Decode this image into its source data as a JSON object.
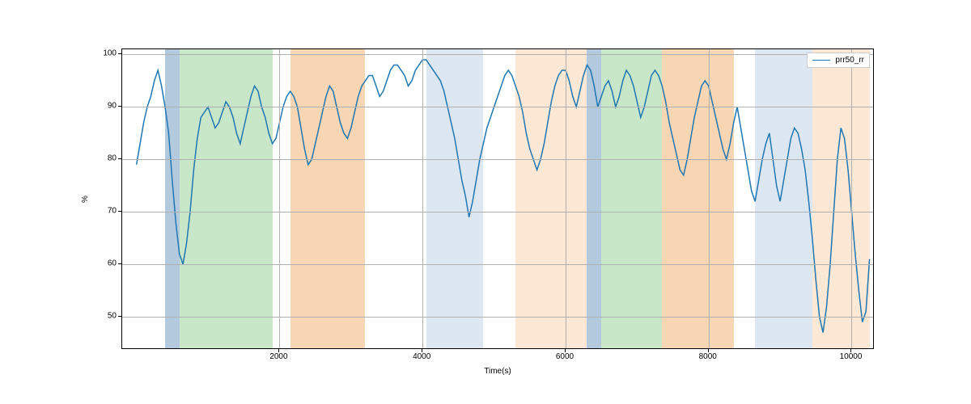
{
  "chart_data": {
    "type": "line",
    "title": "",
    "xlabel": "Time(s)",
    "ylabel": "%",
    "xlim": [
      -200,
      10300
    ],
    "ylim": [
      44,
      101
    ],
    "x_ticks": [
      2000,
      4000,
      6000,
      8000,
      10000
    ],
    "y_ticks": [
      50,
      60,
      70,
      80,
      90,
      100
    ],
    "legend_position": "upper right",
    "grid": true,
    "bands": [
      {
        "x0": 400,
        "x1": 600,
        "color": "#b3c9de",
        "alpha": 0.9
      },
      {
        "x0": 600,
        "x1": 1900,
        "color": "#c8e6c8",
        "alpha": 0.9
      },
      {
        "x0": 2150,
        "x1": 3200,
        "color": "#f8d6b3",
        "alpha": 0.9
      },
      {
        "x0": 4050,
        "x1": 4850,
        "color": "#dde7f2",
        "alpha": 0.9
      },
      {
        "x0": 5300,
        "x1": 6300,
        "color": "#fce8d5",
        "alpha": 0.9
      },
      {
        "x0": 6300,
        "x1": 6500,
        "color": "#b3c9de",
        "alpha": 0.9
      },
      {
        "x0": 6500,
        "x1": 7350,
        "color": "#c8e6c8",
        "alpha": 0.9
      },
      {
        "x0": 7350,
        "x1": 8350,
        "color": "#f8d6b3",
        "alpha": 0.9
      },
      {
        "x0": 8650,
        "x1": 9450,
        "color": "#dde7f2",
        "alpha": 0.9
      },
      {
        "x0": 9450,
        "x1": 10250,
        "color": "#fce8d5",
        "alpha": 0.9
      }
    ],
    "series": [
      {
        "name": "prr50_rr",
        "color": "#1f77b4",
        "x": [
          0,
          50,
          100,
          150,
          200,
          250,
          300,
          350,
          400,
          450,
          500,
          550,
          600,
          650,
          700,
          750,
          800,
          850,
          900,
          950,
          1000,
          1050,
          1100,
          1150,
          1200,
          1250,
          1300,
          1350,
          1400,
          1450,
          1500,
          1550,
          1600,
          1650,
          1700,
          1750,
          1800,
          1850,
          1900,
          1950,
          2000,
          2050,
          2100,
          2150,
          2200,
          2250,
          2300,
          2350,
          2400,
          2450,
          2500,
          2550,
          2600,
          2650,
          2700,
          2750,
          2800,
          2850,
          2900,
          2950,
          3000,
          3050,
          3100,
          3150,
          3200,
          3250,
          3300,
          3350,
          3400,
          3450,
          3500,
          3550,
          3600,
          3650,
          3700,
          3750,
          3800,
          3850,
          3900,
          3950,
          4000,
          4050,
          4100,
          4150,
          4200,
          4250,
          4300,
          4350,
          4400,
          4450,
          4500,
          4550,
          4600,
          4650,
          4700,
          4750,
          4800,
          4850,
          4900,
          4950,
          5000,
          5050,
          5100,
          5150,
          5200,
          5250,
          5300,
          5350,
          5400,
          5450,
          5500,
          5550,
          5600,
          5650,
          5700,
          5750,
          5800,
          5850,
          5900,
          5950,
          6000,
          6050,
          6100,
          6150,
          6200,
          6250,
          6300,
          6350,
          6400,
          6450,
          6500,
          6550,
          6600,
          6650,
          6700,
          6750,
          6800,
          6850,
          6900,
          6950,
          7000,
          7050,
          7100,
          7150,
          7200,
          7250,
          7300,
          7350,
          7400,
          7450,
          7500,
          7550,
          7600,
          7650,
          7700,
          7750,
          7800,
          7850,
          7900,
          7950,
          8000,
          8050,
          8100,
          8150,
          8200,
          8250,
          8300,
          8350,
          8400,
          8450,
          8500,
          8550,
          8600,
          8650,
          8700,
          8750,
          8800,
          8850,
          8900,
          8950,
          9000,
          9050,
          9100,
          9150,
          9200,
          9250,
          9300,
          9350,
          9400,
          9450,
          9500,
          9550,
          9600,
          9650,
          9700,
          9750,
          9800,
          9850,
          9900,
          9950,
          10000,
          10050,
          10100,
          10150,
          10200,
          10250
        ],
        "y": [
          79,
          83,
          87,
          90,
          92,
          95,
          97,
          94,
          90,
          85,
          76,
          68,
          62,
          60,
          64,
          70,
          78,
          84,
          88,
          89,
          90,
          88,
          86,
          87,
          89,
          91,
          90,
          88,
          85,
          83,
          86,
          89,
          92,
          94,
          93,
          90,
          88,
          85,
          83,
          84,
          87,
          90,
          92,
          93,
          92,
          90,
          86,
          82,
          79,
          80,
          83,
          86,
          89,
          92,
          94,
          93,
          90,
          87,
          85,
          84,
          86,
          89,
          92,
          94,
          95,
          96,
          96,
          94,
          92,
          93,
          95,
          97,
          98,
          98,
          97,
          96,
          94,
          95,
          97,
          98,
          99,
          99,
          98,
          97,
          96,
          95,
          93,
          90,
          87,
          84,
          80,
          76,
          73,
          69,
          72,
          76,
          80,
          83,
          86,
          88,
          90,
          92,
          94,
          96,
          97,
          96,
          94,
          92,
          89,
          85,
          82,
          80,
          78,
          80,
          83,
          87,
          91,
          94,
          96,
          97,
          97,
          95,
          92,
          90,
          93,
          96,
          98,
          97,
          94,
          90,
          92,
          94,
          95,
          93,
          90,
          92,
          95,
          97,
          96,
          94,
          91,
          88,
          90,
          93,
          96,
          97,
          96,
          94,
          91,
          87,
          84,
          81,
          78,
          77,
          80,
          84,
          88,
          91,
          94,
          95,
          94,
          91,
          88,
          85,
          82,
          80,
          83,
          87,
          90,
          86,
          82,
          78,
          74,
          72,
          76,
          80,
          83,
          85,
          80,
          75,
          72,
          76,
          80,
          84,
          86,
          85,
          82,
          78,
          72,
          65,
          57,
          50,
          47,
          52,
          60,
          70,
          80,
          86,
          84,
          78,
          70,
          62,
          55,
          49,
          51,
          61
        ]
      }
    ]
  }
}
